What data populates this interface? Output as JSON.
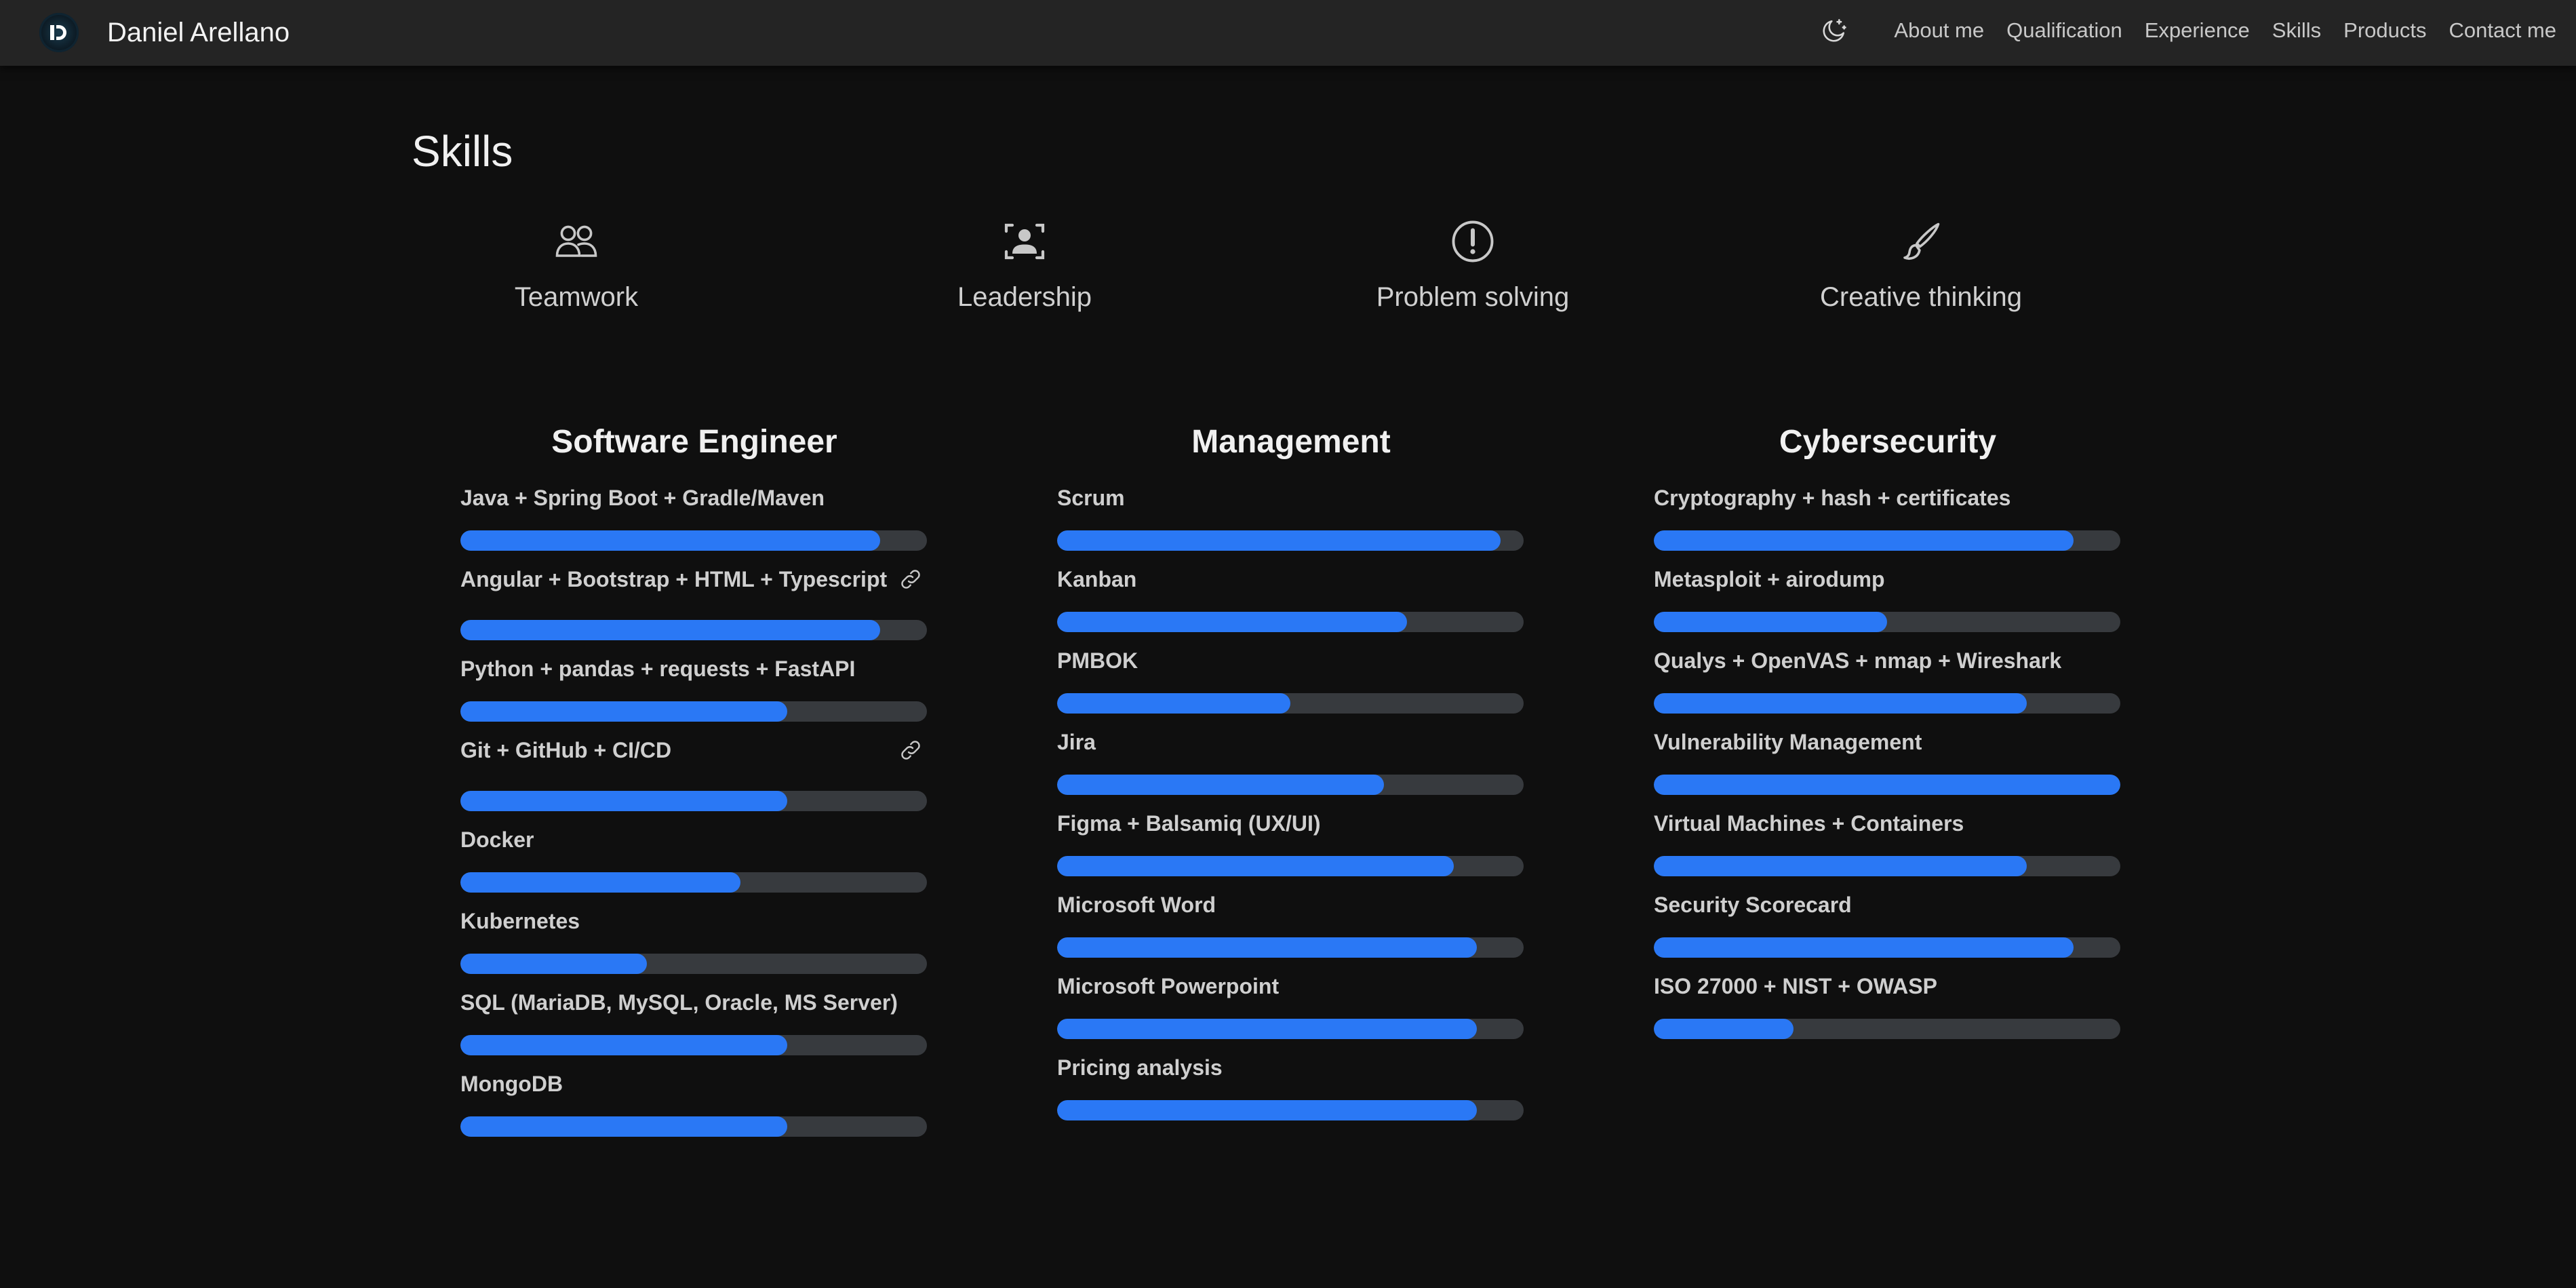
{
  "navbar": {
    "brand_name": "Daniel Arellano",
    "logo_icon": "logo-d-icon",
    "theme_icon": "moon-stars-icon",
    "links": [
      "About me",
      "Qualification",
      "Experience",
      "Skills",
      "Products",
      "Contact me"
    ]
  },
  "page": {
    "title": "Skills"
  },
  "soft_skills": [
    {
      "label": "Teamwork",
      "icon": "people-icon"
    },
    {
      "label": "Leadership",
      "icon": "person-bounding-box-icon"
    },
    {
      "label": "Problem solving",
      "icon": "exclamation-circle-icon"
    },
    {
      "label": "Creative thinking",
      "icon": "brush-icon"
    }
  ],
  "colors": {
    "background": "#0f0f0f",
    "navbar": "#242424",
    "bar_fill": "#2a78f5",
    "bar_track": "#373a3e"
  },
  "categories": [
    {
      "title": "Software Engineer",
      "skills": [
        {
          "label": "Java + Spring Boot + Gradle/Maven",
          "level": 0.9,
          "link": false
        },
        {
          "label": "Angular + Bootstrap + HTML + Typescript",
          "level": 0.9,
          "link": true
        },
        {
          "label": "Python + pandas + requests + FastAPI",
          "level": 0.7,
          "link": false
        },
        {
          "label": "Git + GitHub + CI/CD",
          "level": 0.7,
          "link": true
        },
        {
          "label": "Docker",
          "level": 0.6,
          "link": false
        },
        {
          "label": "Kubernetes",
          "level": 0.4,
          "link": false
        },
        {
          "label": "SQL (MariaDB, MySQL, Oracle, MS Server)",
          "level": 0.7,
          "link": false
        },
        {
          "label": "MongoDB",
          "level": 0.7,
          "link": false
        }
      ]
    },
    {
      "title": "Management",
      "skills": [
        {
          "label": "Scrum",
          "level": 0.95,
          "link": false
        },
        {
          "label": "Kanban",
          "level": 0.75,
          "link": false
        },
        {
          "label": "PMBOK",
          "level": 0.5,
          "link": false
        },
        {
          "label": "Jira",
          "level": 0.7,
          "link": false
        },
        {
          "label": "Figma + Balsamiq (UX/UI)",
          "level": 0.85,
          "link": false
        },
        {
          "label": "Microsoft Word",
          "level": 0.9,
          "link": false
        },
        {
          "label": "Microsoft Powerpoint",
          "level": 0.9,
          "link": false
        },
        {
          "label": "Pricing analysis",
          "level": 0.9,
          "link": false
        }
      ]
    },
    {
      "title": "Cybersecurity",
      "skills": [
        {
          "label": "Cryptography + hash + certificates",
          "level": 0.9,
          "link": false
        },
        {
          "label": "Metasploit + airodump",
          "level": 0.5,
          "link": false
        },
        {
          "label": "Qualys + OpenVAS + nmap + Wireshark",
          "level": 0.8,
          "link": false
        },
        {
          "label": "Vulnerability Management",
          "level": 1.0,
          "link": false
        },
        {
          "label": "Virtual Machines + Containers",
          "level": 0.8,
          "link": false
        },
        {
          "label": "Security Scorecard",
          "level": 0.9,
          "link": false
        },
        {
          "label": "ISO 27000 + NIST + OWASP",
          "level": 0.3,
          "link": false
        }
      ]
    }
  ]
}
